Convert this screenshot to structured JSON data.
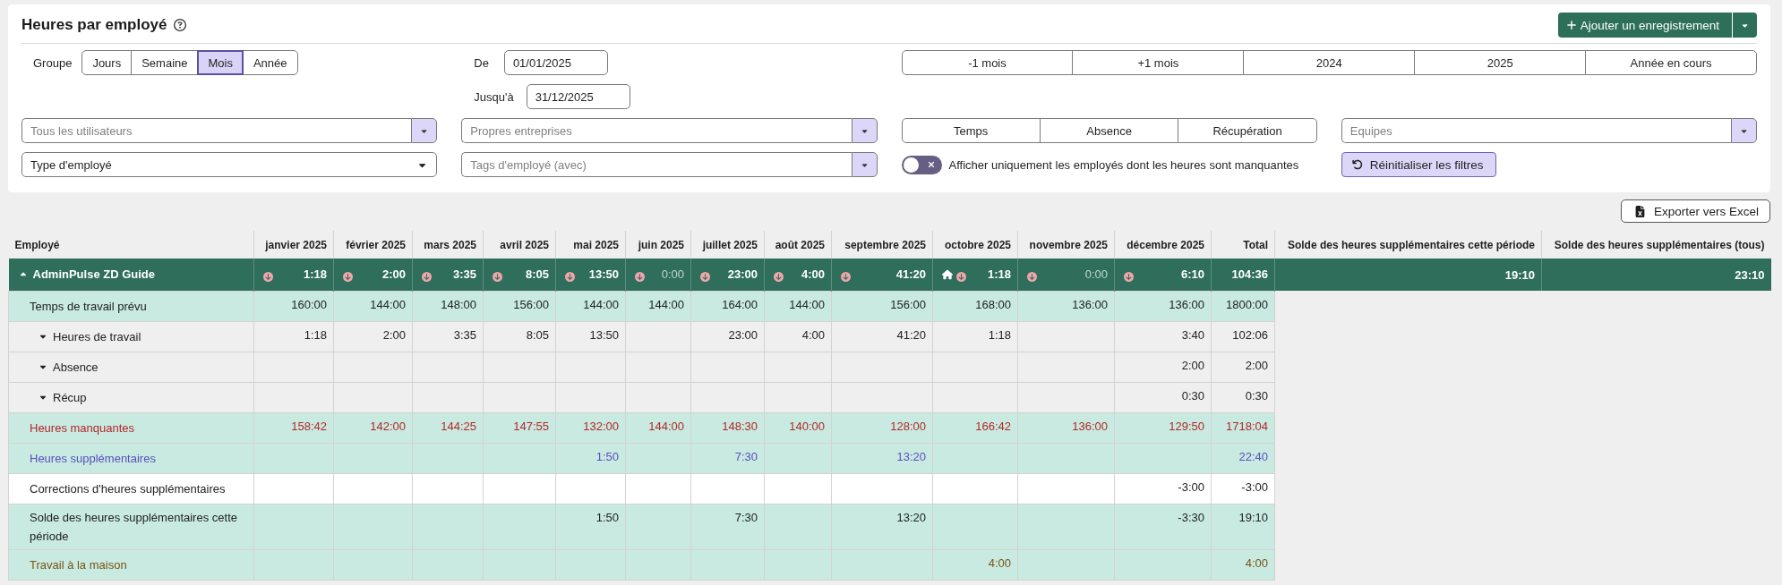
{
  "header": {
    "title": "Heures par employé",
    "add_button": "Ajouter un enregistrement"
  },
  "filters": {
    "grouping": {
      "label": "Groupe",
      "options": [
        {
          "label": "Jours",
          "selected": false
        },
        {
          "label": "Semaine",
          "selected": false
        },
        {
          "label": "Mois",
          "selected": true
        },
        {
          "label": "Année",
          "selected": false
        }
      ]
    },
    "date_from": {
      "label": "De",
      "value": "01/01/2025"
    },
    "periods": [
      "-1 mois",
      "+1 mois",
      "2024",
      "2025",
      "Année en cours"
    ],
    "date_to": {
      "label": "Jusqu'à",
      "value": "31/12/2025"
    },
    "selects": [
      {
        "kind": "multi",
        "placeholder": "Tous les utilisateurs"
      },
      {
        "kind": "multi",
        "placeholder": "Propres entreprises"
      },
      {
        "kind": "multi",
        "placeholder": "Equipes"
      },
      {
        "kind": "native",
        "value": "Type d'employé"
      },
      {
        "kind": "multi",
        "placeholder": "Tags d'employé (avec)"
      }
    ],
    "record_types": [
      {
        "label": "Temps",
        "selected": false
      },
      {
        "label": "Absence",
        "selected": false
      },
      {
        "label": "Récupération",
        "selected": false
      }
    ],
    "missing_only": {
      "label": "Afficher uniquement les employés dont les heures sont manquantes",
      "on": false
    },
    "reset_button": "Réinitialiser les filtres"
  },
  "export_button": "Exporter vers Excel",
  "table": {
    "columns": [
      "Employé",
      "janvier 2025",
      "février 2025",
      "mars 2025",
      "avril 2025",
      "mai 2025",
      "juin 2025",
      "juillet 2025",
      "août 2025",
      "septembre 2025",
      "octobre 2025",
      "novembre 2025",
      "décembre 2025",
      "Total",
      "Solde des heures supplémentaires cette période",
      "Solde des heures supplémentaires (tous)"
    ],
    "group": {
      "name": "AdminPulse ZD Guide",
      "expanded": true,
      "months": [
        {
          "value": "1:18",
          "missing": true,
          "home": false,
          "dimmed": false
        },
        {
          "value": "2:00",
          "missing": true,
          "home": false,
          "dimmed": false
        },
        {
          "value": "3:35",
          "missing": true,
          "home": false,
          "dimmed": false
        },
        {
          "value": "8:05",
          "missing": true,
          "home": false,
          "dimmed": false
        },
        {
          "value": "13:50",
          "missing": true,
          "home": false,
          "dimmed": false
        },
        {
          "value": "0:00",
          "missing": true,
          "home": false,
          "dimmed": true
        },
        {
          "value": "23:00",
          "missing": true,
          "home": false,
          "dimmed": false
        },
        {
          "value": "4:00",
          "missing": true,
          "home": false,
          "dimmed": false
        },
        {
          "value": "41:20",
          "missing": true,
          "home": false,
          "dimmed": false
        },
        {
          "value": "1:18",
          "missing": true,
          "home": true,
          "dimmed": false
        },
        {
          "value": "0:00",
          "missing": true,
          "home": false,
          "dimmed": true
        },
        {
          "value": "6:10",
          "missing": true,
          "home": false,
          "dimmed": false
        }
      ],
      "total": "104:36",
      "balance_period": "19:10",
      "balance_all": "23:10"
    },
    "rows": [
      {
        "kind": "planned",
        "label": "Temps de travail prévu",
        "months": {
          "jan": "160:00",
          "feb": "144:00",
          "mar": "148:00",
          "apr": "156:00",
          "may": "144:00",
          "jun": "144:00",
          "jul": "164:00",
          "aug": "144:00",
          "sep": "156:00",
          "oct": "168:00",
          "nov": "136:00",
          "dec": "136:00"
        },
        "total": "1800:00"
      },
      {
        "kind": "detail",
        "label": "Heures de travail",
        "expanded": false,
        "months": {
          "jan": "1:18",
          "feb": "2:00",
          "mar": "3:35",
          "apr": "8:05",
          "may": "13:50",
          "jul": "23:00",
          "aug": "4:00",
          "sep": "41:20",
          "oct": "1:18",
          "dec": "3:40"
        },
        "total": "102:06"
      },
      {
        "kind": "detail",
        "label": "Absence",
        "expanded": false,
        "months": {
          "dec": "2:00"
        },
        "total": "2:00"
      },
      {
        "kind": "detail",
        "label": "Récup",
        "expanded": false,
        "months": {
          "dec": "0:30"
        },
        "total": "0:30"
      },
      {
        "kind": "missing",
        "label": "Heures manquantes",
        "months": {
          "jan": "158:42",
          "feb": "142:00",
          "mar": "144:25",
          "apr": "147:55",
          "may": "132:00",
          "jun": "144:00",
          "jul": "148:30",
          "aug": "140:00",
          "sep": "128:00",
          "oct": "166:42",
          "nov": "136:00",
          "dec": "129:50"
        },
        "total": "1718:04"
      },
      {
        "kind": "overtime",
        "label": "Heures supplémentaires",
        "months": {
          "may": "1:50",
          "jul": "7:30",
          "sep": "13:20"
        },
        "total": "22:40"
      },
      {
        "kind": "correction",
        "label": "Corrections d'heures supplémentaires",
        "months": {
          "dec": "-3:00"
        },
        "total": "-3:00"
      },
      {
        "kind": "balance",
        "label": "Solde des heures supplémentaires cette période",
        "months": {
          "may": "1:50",
          "jul": "7:30",
          "sep": "13:20",
          "dec": "-3:30"
        },
        "total": "19:10"
      },
      {
        "kind": "home",
        "label": "Travail à la maison",
        "months": {
          "oct": "4:00"
        },
        "total": "4:00"
      }
    ]
  }
}
